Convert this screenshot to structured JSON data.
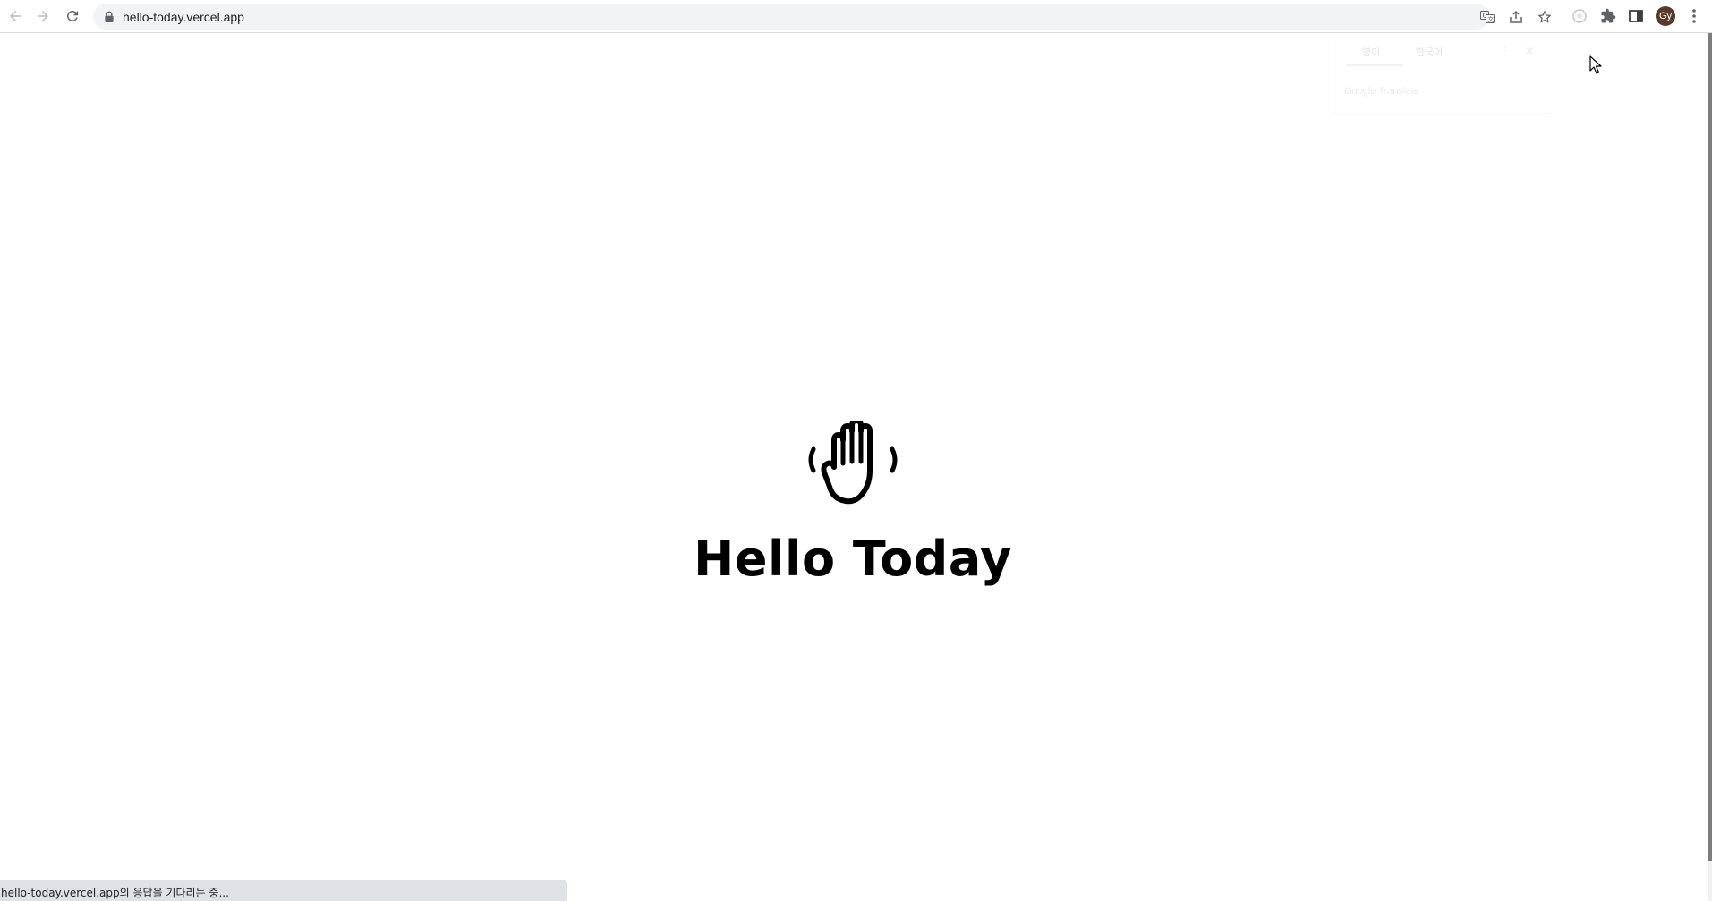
{
  "browser": {
    "url": "hello-today.vercel.app",
    "profile_initials": "Gy",
    "icons": [
      "back-icon",
      "forward-icon",
      "reload-icon",
      "lock-icon",
      "translate-icon",
      "share-icon",
      "star-icon",
      "extension-icon",
      "puzzle-icon",
      "side-panel-icon",
      "menu-icon"
    ]
  },
  "translate_popup": {
    "tab_source": "영어",
    "tab_target": "한국어",
    "footer": "Google Translate"
  },
  "page": {
    "icon": "waving-hand-icon",
    "title": "Hello Today"
  },
  "status_bar": {
    "text": "hello-today.vercel.app의 응답을 기다리는 중..."
  },
  "colors": {
    "toolbar_bg": "#ffffff",
    "omnibox_bg": "#f1f3f4",
    "text": "#000000",
    "status_bg": "#dee1e6"
  }
}
